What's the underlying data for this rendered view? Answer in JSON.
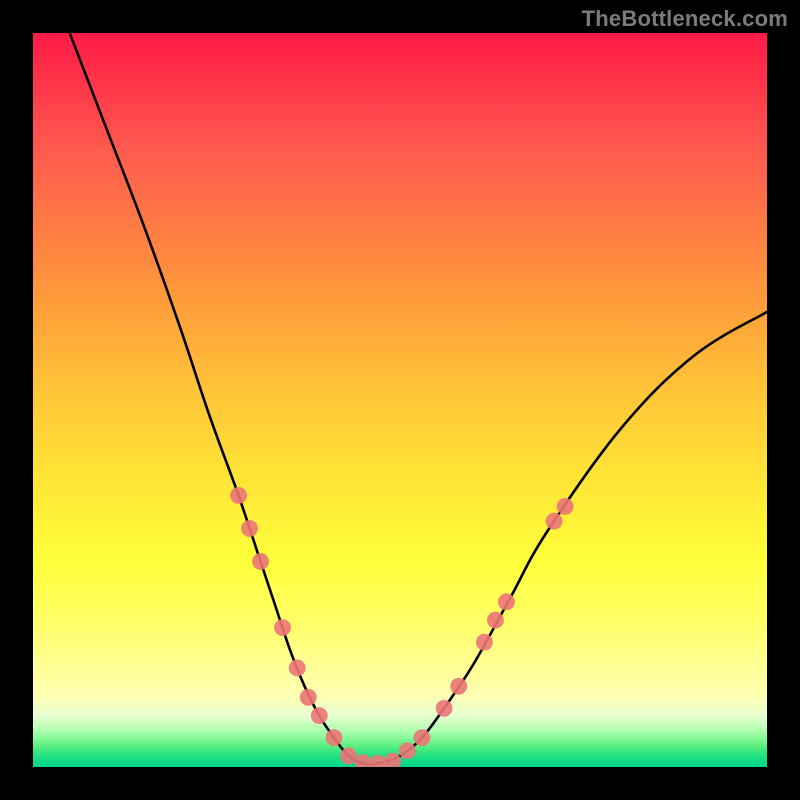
{
  "watermark": {
    "text": "TheBottleneck.com"
  },
  "chart_data": {
    "type": "line",
    "title": "",
    "xlabel": "",
    "ylabel": "",
    "xlim": [
      0,
      100
    ],
    "ylim": [
      0,
      100
    ],
    "grid": false,
    "series": [
      {
        "name": "bottleneck-curve",
        "color": "#000000",
        "x": [
          5,
          10,
          15,
          20,
          24,
          28,
          31,
          33,
          35,
          37,
          39,
          41,
          43,
          45,
          47,
          50,
          53,
          56,
          60,
          65,
          70,
          80,
          90,
          100
        ],
        "y": [
          100,
          87,
          74,
          60,
          48,
          37,
          28,
          22,
          16,
          11,
          7,
          4,
          1.5,
          0.5,
          0.5,
          1.5,
          4,
          8,
          14,
          23,
          32,
          46,
          56,
          62
        ]
      }
    ],
    "markers": {
      "name": "highlighted-points",
      "color": "#ec7678",
      "radius_pct": 1.15,
      "points": [
        {
          "x": 28,
          "y": 37
        },
        {
          "x": 29.5,
          "y": 32.5
        },
        {
          "x": 31,
          "y": 28
        },
        {
          "x": 34,
          "y": 19
        },
        {
          "x": 36,
          "y": 13.5
        },
        {
          "x": 37.5,
          "y": 9.5
        },
        {
          "x": 39,
          "y": 7
        },
        {
          "x": 41,
          "y": 4
        },
        {
          "x": 43,
          "y": 1.5
        },
        {
          "x": 45,
          "y": 0.6
        },
        {
          "x": 47,
          "y": 0.5
        },
        {
          "x": 49,
          "y": 0.8
        },
        {
          "x": 51,
          "y": 2.2
        },
        {
          "x": 53,
          "y": 4
        },
        {
          "x": 56,
          "y": 8
        },
        {
          "x": 58,
          "y": 11
        },
        {
          "x": 61.5,
          "y": 17
        },
        {
          "x": 63,
          "y": 20
        },
        {
          "x": 64.5,
          "y": 22.5
        },
        {
          "x": 71,
          "y": 33.5
        },
        {
          "x": 72.5,
          "y": 35.5
        }
      ]
    }
  }
}
